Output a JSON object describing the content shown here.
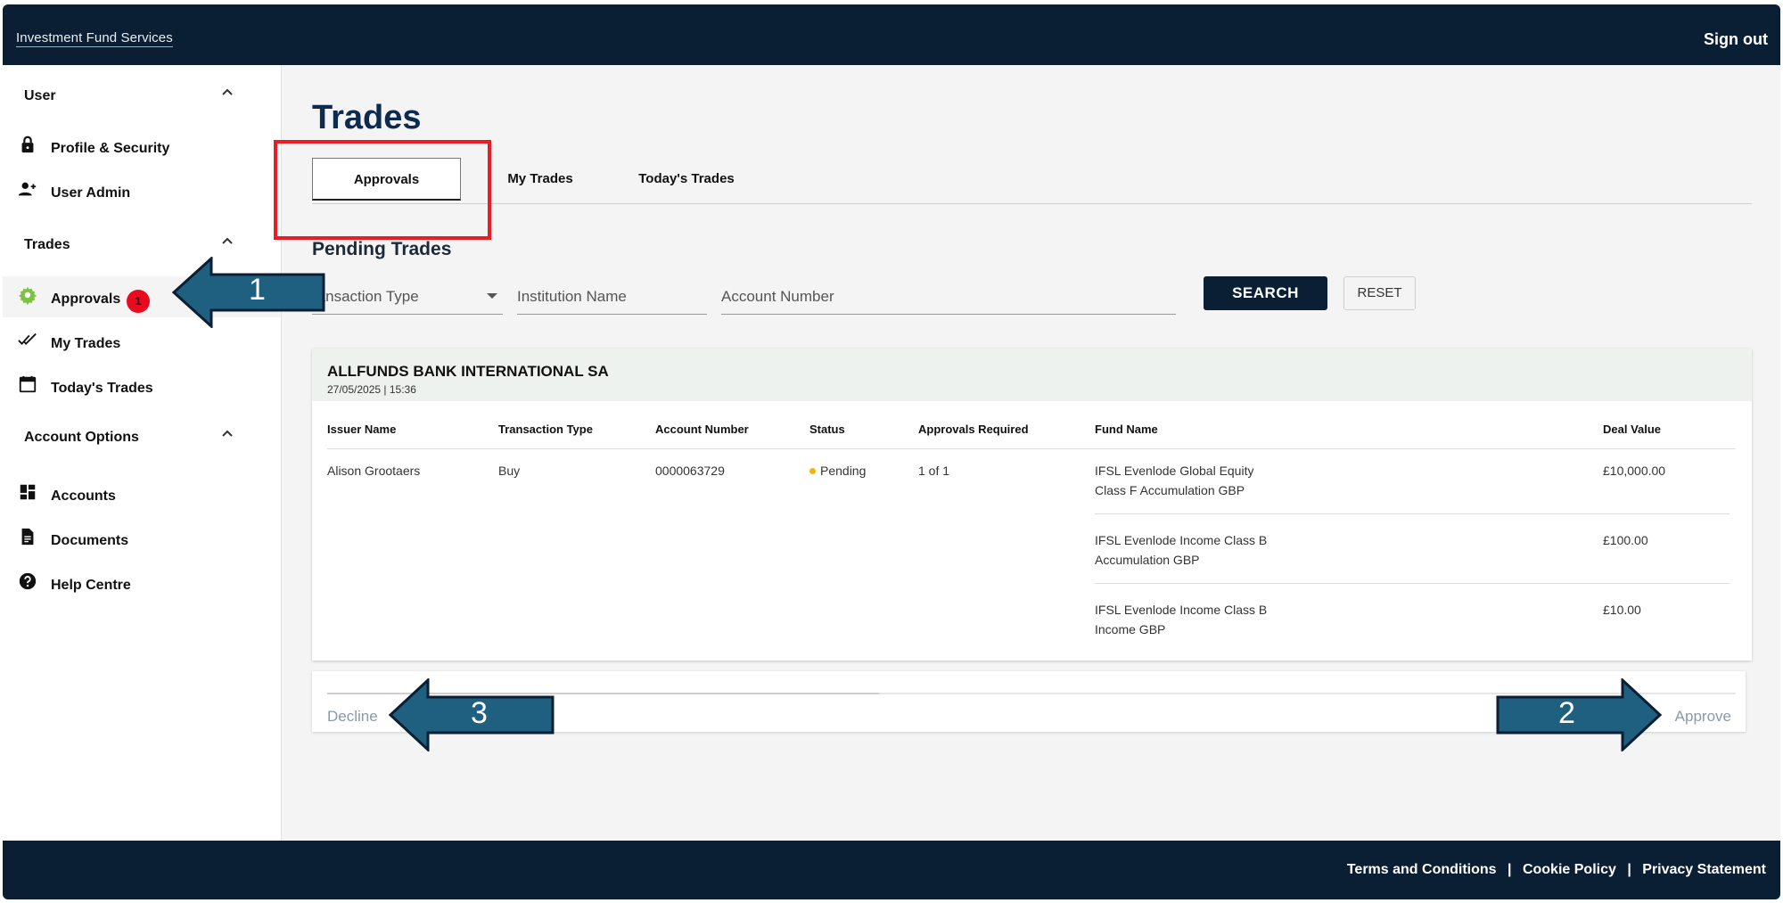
{
  "header": {
    "brand": "Investment Fund Services",
    "sign_out": "Sign out"
  },
  "sidebar": {
    "user_title": "User",
    "profile": "Profile & Security",
    "user_admin": "User Admin",
    "trades_title": "Trades",
    "approvals": "Approvals",
    "approvals_badge": "1",
    "my_trades": "My Trades",
    "todays_trades": "Today's Trades",
    "account_title": "Account Options",
    "accounts": "Accounts",
    "documents": "Documents",
    "help": "Help Centre"
  },
  "main": {
    "title": "Trades",
    "tabs": [
      {
        "label": "Approvals"
      },
      {
        "label": "My Trades"
      },
      {
        "label": "Today's Trades"
      }
    ],
    "pending_title": "Pending Trades",
    "filters": {
      "transaction_type": "ransaction Type",
      "institution_name": "Institution Name",
      "account_number": "Account Number"
    },
    "search_label": "SEARCH",
    "reset_label": "RESET"
  },
  "card": {
    "institution": "ALLFUNDS BANK INTERNATIONAL SA",
    "datetime": "27/05/2025 | 15:36",
    "columns": {
      "issuer": "Issuer Name",
      "transaction_type": "Transaction Type",
      "account_number": "Account Number",
      "status": "Status",
      "approvals": "Approvals Required",
      "fund": "Fund Name",
      "deal": "Deal Value"
    },
    "row": {
      "issuer": "Alison Grootaers",
      "transaction_type": "Buy",
      "account_number": "0000063729",
      "status": "Pending",
      "approvals": "1 of 1"
    },
    "funds": [
      {
        "line1": "IFSL Evenlode Global Equity",
        "line2": "Class F Accumulation GBP",
        "value": "£10,000.00"
      },
      {
        "line1": "IFSL Evenlode Income Class B",
        "line2": "Accumulation GBP",
        "value": "£100.00"
      },
      {
        "line1": "IFSL Evenlode Income Class B",
        "line2": "Income GBP",
        "value": "£10.00"
      }
    ]
  },
  "actions": {
    "decline": "Decline",
    "approve": "Approve"
  },
  "callouts": {
    "one": "1",
    "two": "2",
    "three": "3"
  },
  "footer": {
    "terms": "Terms and Conditions",
    "cookie": "Cookie Policy",
    "privacy": "Privacy Statement",
    "separator": "|"
  },
  "colors": {
    "navy": "#0a1f33",
    "title_blue": "#0d2a4f",
    "badge_red": "#ea0a1f",
    "highlight_red": "#ea1c24",
    "arrow_blue": "#1f5f80",
    "pending_dot": "#f5b400",
    "approvals_icon": "#7dc242"
  }
}
